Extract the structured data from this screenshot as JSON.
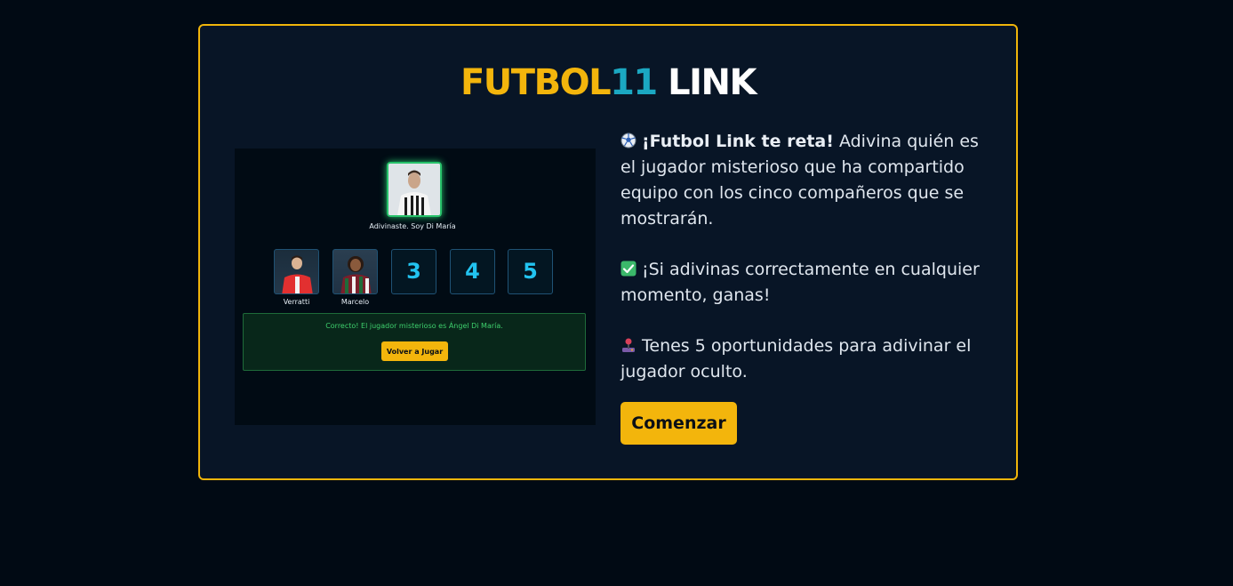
{
  "logo": {
    "part1": "FUTBOL",
    "part2": "11",
    "part3": " LINK"
  },
  "preview": {
    "mystery_caption": "Adivinaste. Soy Di María",
    "slots": [
      {
        "label": "Verratti"
      },
      {
        "label": "Marcelo"
      },
      {
        "number": "3"
      },
      {
        "number": "4"
      },
      {
        "number": "5"
      }
    ],
    "result_text": "Correcto! El jugador misterioso es Ángel Di María.",
    "replay_label": "Volver a Jugar"
  },
  "intro": {
    "p1_icon": "soccer-ball-icon",
    "p1_bold": "¡Futbol Link te reta!",
    "p1_text": " Adivina quién es el jugador misterioso que ha compartido equipo con los cinco compañeros que se mostrarán.",
    "p2_icon": "check-mark-icon",
    "p2_text": "¡Si adivinas correctamente en cualquier momento, ganas!",
    "p3_icon": "joystick-icon",
    "p3_text": "Tenes 5 oportunidades para adivinar el jugador oculto."
  },
  "start_label": "Comenzar",
  "colors": {
    "accent": "#f3b50c",
    "accent2": "#1ba8c2",
    "success": "#27c26a",
    "background": "#010a14",
    "card": "#081526"
  }
}
